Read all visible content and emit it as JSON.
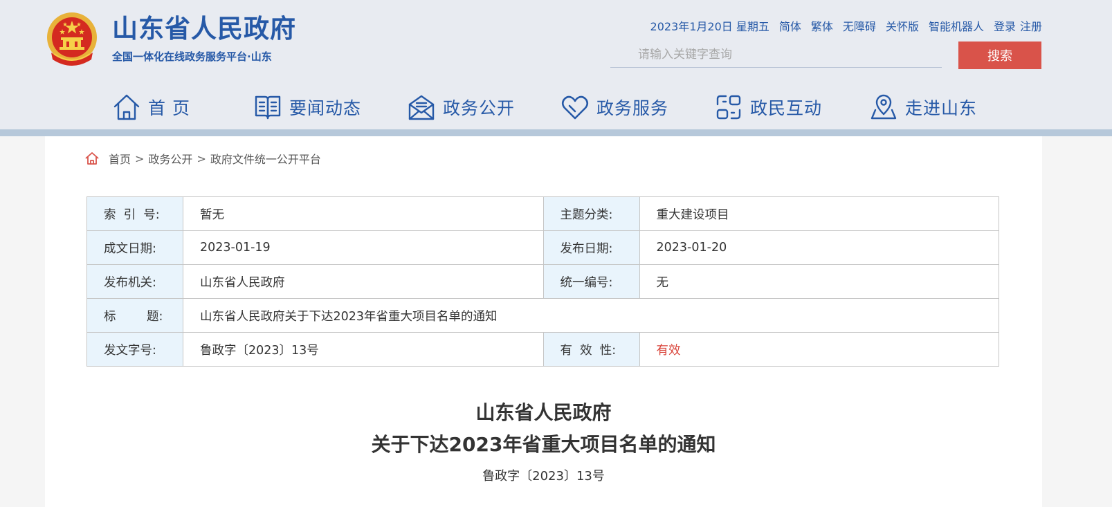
{
  "header": {
    "site_title": "山东省人民政府",
    "site_subtitle": "全国一体化在线政务服务平台·山东",
    "top_links": {
      "date": "2023年1月20日 星期五",
      "simplified": "简体",
      "traditional": "繁体",
      "accessibility": "无障碍",
      "elderly": "关怀版",
      "robot": "智能机器人",
      "login": "登录",
      "register": "注册"
    },
    "search": {
      "placeholder": "请输入关键字查询",
      "button": "搜索"
    },
    "nav": [
      {
        "label": "首 页",
        "icon": "home-icon"
      },
      {
        "label": "要闻动态",
        "icon": "book-icon"
      },
      {
        "label": "政务公开",
        "icon": "envelope-icon"
      },
      {
        "label": "政务服务",
        "icon": "heart-icon"
      },
      {
        "label": "政民互动",
        "icon": "interact-icon"
      },
      {
        "label": "走进山东",
        "icon": "map-pin-icon"
      }
    ]
  },
  "breadcrumb": {
    "home": "首页",
    "sep": ">",
    "level1": "政务公开",
    "level2": "政府文件统一公开平台"
  },
  "info_table": {
    "index_label": "索  引  号:",
    "index_value": "暂无",
    "topic_label": "主题分类:",
    "topic_value": "重大建设项目",
    "written_label": "成文日期:",
    "written_value": "2023-01-19",
    "published_label": "发布日期:",
    "published_value": "2023-01-20",
    "issuer_label": "发布机关:",
    "issuer_value": "山东省人民政府",
    "code_label": "统一编号:",
    "code_value": "无",
    "title_label": "标        题:",
    "title_value": "山东省人民政府关于下达2023年省重大项目名单的通知",
    "docno_label": "发文字号:",
    "docno_value": "鲁政字〔2023〕13号",
    "validity_label": "有  效  性:",
    "validity_value": "有效"
  },
  "document": {
    "title_line1": "山东省人民政府",
    "title_line2": "关于下达2023年省重大项目名单的通知",
    "doc_number": "鲁政字〔2023〕13号"
  },
  "colors": {
    "brand_blue": "#2659a7",
    "accent_red": "#d9534a",
    "label_bg": "#e9f4fc"
  }
}
